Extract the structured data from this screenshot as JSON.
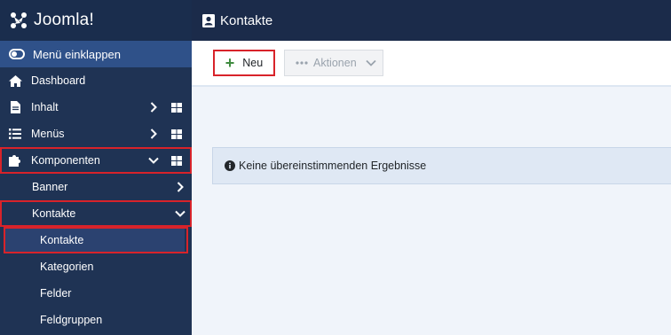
{
  "brand": {
    "name": "Joomla!"
  },
  "sidebar": {
    "collapse_label": "Menü einklappen",
    "items": [
      {
        "label": "Dashboard",
        "icon": "home-icon"
      },
      {
        "label": "Inhalt",
        "icon": "file-icon"
      },
      {
        "label": "Menüs",
        "icon": "list-icon"
      },
      {
        "label": "Komponenten",
        "icon": "puzzle-icon"
      }
    ],
    "sub": {
      "banner": "Banner",
      "kontakte": "Kontakte",
      "kontakte_child": "Kontakte",
      "kategorien": "Kategorien",
      "felder": "Felder",
      "feldgruppen": "Feldgruppen"
    }
  },
  "header": {
    "title": "Kontakte",
    "icon": "address-card-icon"
  },
  "toolbar": {
    "new_label": "Neu",
    "actions_label": "Aktionen"
  },
  "alert": {
    "message": "Keine übereinstimmenden Ergebnisse",
    "icon": "info-circle-icon"
  },
  "colors": {
    "sidebar": "#1f3354",
    "highlight": "#d8232a",
    "accent": "#2f5189"
  }
}
